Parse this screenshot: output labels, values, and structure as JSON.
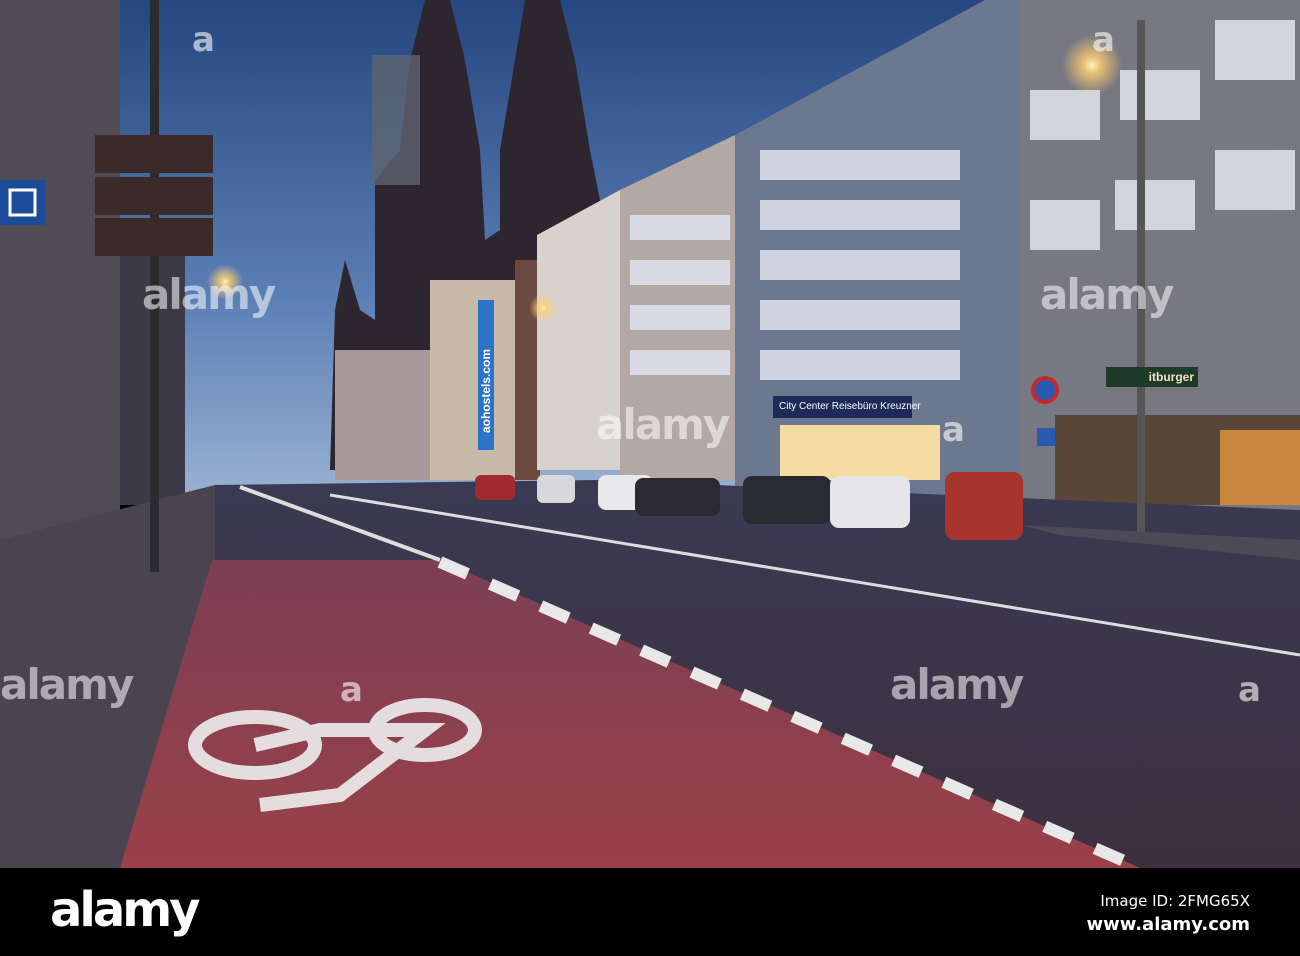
{
  "photo": {
    "signs": {
      "hostel": "aohostels.com",
      "travel_agency": "City Center Reisebüro Kreuzner",
      "pub": "itburger"
    },
    "colors": {
      "sky_top": "#25467f",
      "sky_bottom": "#8aa6cc",
      "bike_lane": "#8c3f48",
      "road": "#3b3444",
      "street_light": "#ffcf70"
    }
  },
  "watermark": {
    "text": "alamy",
    "letter": "a"
  },
  "footer": {
    "logo": "alamy",
    "image_id": "Image ID: 2FMG65X",
    "url": "www.alamy.com"
  }
}
